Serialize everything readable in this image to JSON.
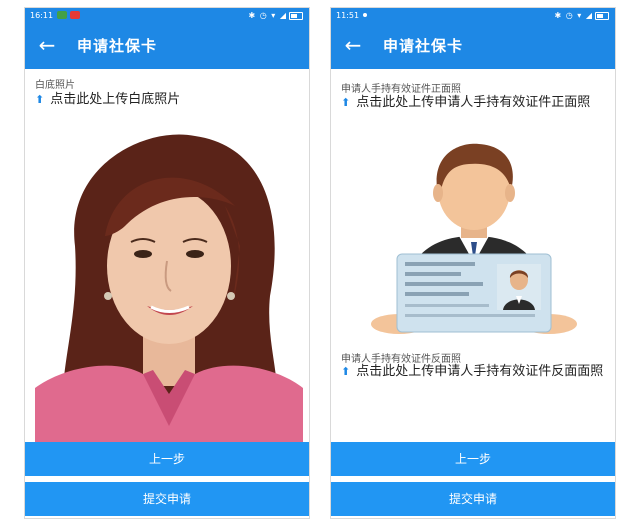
{
  "left_screen": {
    "status": {
      "time": "16:11"
    },
    "header": {
      "back_icon": "arrow-left-icon",
      "title": "申请社保卡"
    },
    "photo_field": {
      "label": "白底照片",
      "upload_icon": "upload-arrow-icon",
      "upload_text": "点击此处上传白底照片"
    },
    "buttons": {
      "prev": "上一步",
      "submit": "提交申请"
    }
  },
  "right_screen": {
    "status": {
      "time": "11:51"
    },
    "header": {
      "back_icon": "arrow-left-icon",
      "title": "申请社保卡"
    },
    "front_field": {
      "label": "申请人手持有效证件正面照",
      "upload_icon": "upload-arrow-icon",
      "upload_text": "点击此处上传申请人手持有效证件正面照"
    },
    "back_field": {
      "label": "申请人手持有效证件反面照",
      "upload_icon": "upload-arrow-icon",
      "upload_text": "点击此处上传申请人手持有效证件反面面照"
    },
    "buttons": {
      "prev": "上一步",
      "submit": "提交申请"
    }
  },
  "colors": {
    "primary": "#1e88e5",
    "button": "#2196f3",
    "text": "#222222",
    "label": "#555555"
  }
}
